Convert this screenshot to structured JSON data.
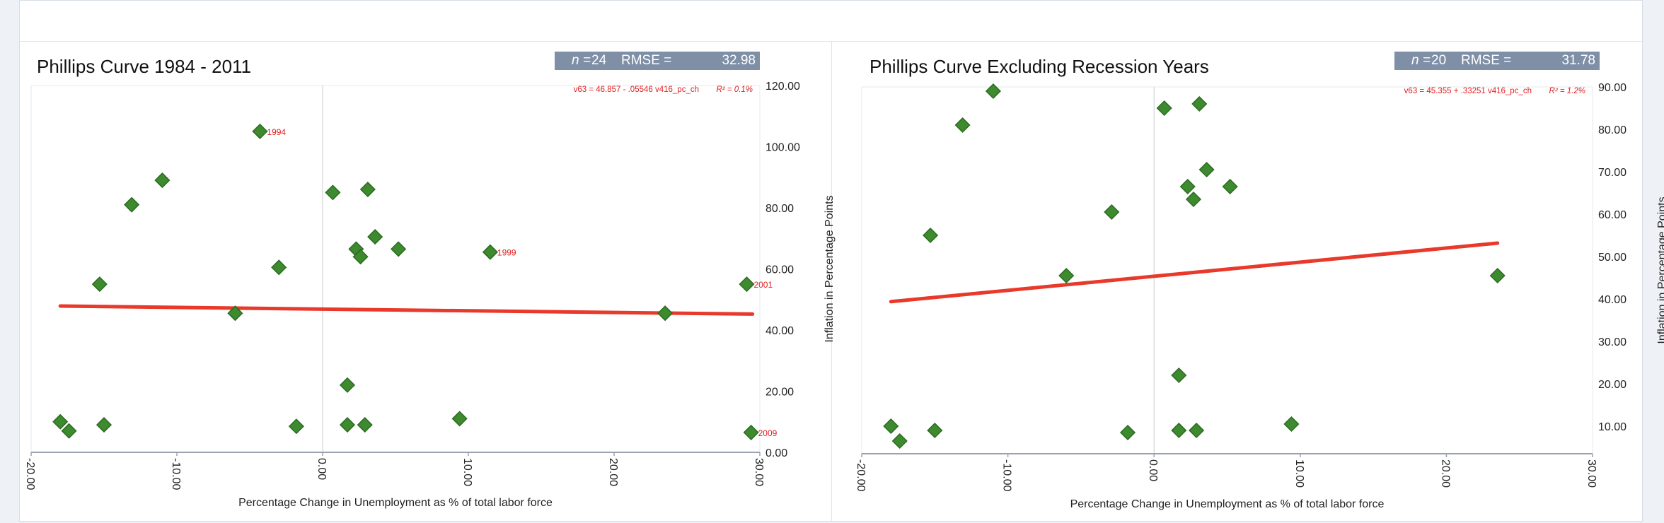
{
  "colors": {
    "point": "#3d8a2f",
    "point_edge": "#2b6b20",
    "fit_line": "#e8392a",
    "annotation": "#e02020",
    "stats_box": "#7e8fa6",
    "axis": "#9aa3ad"
  },
  "chart_data": [
    {
      "type": "scatter",
      "title": "Phillips Curve 1984 - 2011",
      "stats": {
        "n_label": "n =",
        "n_value": "24",
        "rmse_label": "RMSE =",
        "rmse_value": "32.98"
      },
      "equation": "v63 = 46.857 - .05546 v416_pc_ch",
      "r2": "R² = 0.1%",
      "xlabel": "Percentage Change in Unemployment as % of total labor force",
      "ylabel": "Inflation in Percentage Points",
      "xlim": [
        -20,
        30
      ],
      "ylim": [
        0,
        120
      ],
      "x_ticks": [
        "-20.00",
        "-10.00",
        "0.00",
        "10.00",
        "20.00",
        "30.00"
      ],
      "y_ticks": [
        "0.00",
        "20.00",
        "40.00",
        "60.00",
        "80.00",
        "100.00",
        "120.00"
      ],
      "y_axis_side": "right",
      "grid": false,
      "zero_line_x": 0,
      "fit_line": {
        "intercept": 46.857,
        "slope": -0.05546,
        "x_range": [
          -18,
          29.5
        ]
      },
      "points": [
        {
          "x": -4.3,
          "y": 105.0,
          "label": "1994"
        },
        {
          "x": -11.0,
          "y": 89.0,
          "label": ""
        },
        {
          "x": -13.1,
          "y": 81.0,
          "label": ""
        },
        {
          "x": -15.3,
          "y": 55.0,
          "label": ""
        },
        {
          "x": -3.0,
          "y": 60.5,
          "label": ""
        },
        {
          "x": -6.0,
          "y": 45.5,
          "label": ""
        },
        {
          "x": 0.7,
          "y": 85.0,
          "label": ""
        },
        {
          "x": 3.1,
          "y": 86.0,
          "label": ""
        },
        {
          "x": 3.6,
          "y": 70.5,
          "label": ""
        },
        {
          "x": 2.3,
          "y": 66.5,
          "label": ""
        },
        {
          "x": 2.6,
          "y": 64.0,
          "label": ""
        },
        {
          "x": 5.2,
          "y": 66.5,
          "label": ""
        },
        {
          "x": 11.5,
          "y": 65.5,
          "label": "1999"
        },
        {
          "x": 29.1,
          "y": 55.0,
          "label": "2001"
        },
        {
          "x": 23.5,
          "y": 45.5,
          "label": ""
        },
        {
          "x": 1.7,
          "y": 22.0,
          "label": ""
        },
        {
          "x": -18.0,
          "y": 10.0,
          "label": ""
        },
        {
          "x": -17.4,
          "y": 7.0,
          "label": ""
        },
        {
          "x": -15.0,
          "y": 9.0,
          "label": ""
        },
        {
          "x": -1.8,
          "y": 8.5,
          "label": ""
        },
        {
          "x": 1.7,
          "y": 9.0,
          "label": ""
        },
        {
          "x": 2.9,
          "y": 9.0,
          "label": ""
        },
        {
          "x": 9.4,
          "y": 11.0,
          "label": ""
        },
        {
          "x": 29.4,
          "y": 6.5,
          "label": "2009"
        }
      ]
    },
    {
      "type": "scatter",
      "title": "Phillips Curve Excluding Recession Years",
      "stats": {
        "n_label": "n =",
        "n_value": "20",
        "rmse_label": "RMSE =",
        "rmse_value": "31.78"
      },
      "equation": "v63 = 45.355 + .33251 v416_pc_ch",
      "r2": "R² = 1.2%",
      "xlabel": "Percentage Change in Unemployment as % of total labor force",
      "ylabel": "Inflation in Percentage Points",
      "xlim": [
        -20,
        30
      ],
      "ylim": [
        3.5,
        90
      ],
      "x_ticks": [
        "-20.00",
        "-10.00",
        "0.00",
        "10.00",
        "20.00",
        "30.00"
      ],
      "y_ticks": [
        "10.00",
        "20.00",
        "30.00",
        "40.00",
        "50.00",
        "60.00",
        "70.00",
        "80.00",
        "90.00"
      ],
      "y_axis_side": "right",
      "grid": false,
      "zero_line_x": 0,
      "fit_line": {
        "intercept": 45.355,
        "slope": 0.33251,
        "x_range": [
          -18,
          23.5
        ]
      },
      "points": [
        {
          "x": -11.0,
          "y": 89.0
        },
        {
          "x": -13.1,
          "y": 81.0
        },
        {
          "x": -15.3,
          "y": 55.0
        },
        {
          "x": -2.9,
          "y": 60.5
        },
        {
          "x": -6.0,
          "y": 45.5
        },
        {
          "x": 0.7,
          "y": 85.0
        },
        {
          "x": 3.1,
          "y": 86.0
        },
        {
          "x": 3.6,
          "y": 70.5
        },
        {
          "x": 2.3,
          "y": 66.5
        },
        {
          "x": 2.7,
          "y": 63.5
        },
        {
          "x": 5.2,
          "y": 66.5
        },
        {
          "x": 23.5,
          "y": 45.5
        },
        {
          "x": 1.7,
          "y": 22.0
        },
        {
          "x": -18.0,
          "y": 10.0
        },
        {
          "x": -17.4,
          "y": 6.5
        },
        {
          "x": -15.0,
          "y": 9.0
        },
        {
          "x": -1.8,
          "y": 8.5
        },
        {
          "x": 1.7,
          "y": 9.0
        },
        {
          "x": 2.9,
          "y": 9.0
        },
        {
          "x": 9.4,
          "y": 10.5
        }
      ]
    }
  ]
}
